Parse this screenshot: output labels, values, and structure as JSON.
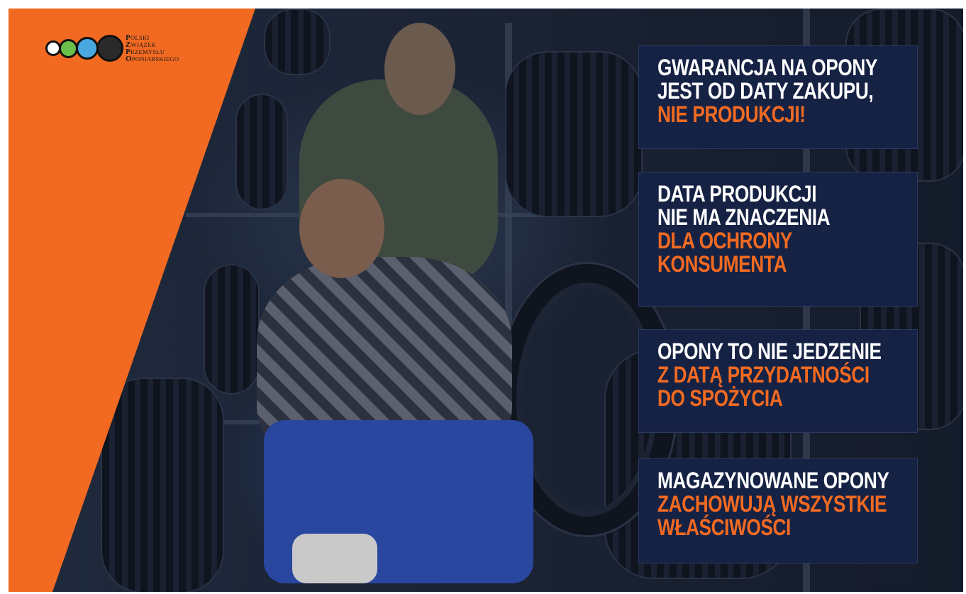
{
  "logo": {
    "lines": [
      {
        "cap": "P",
        "rest": "OLSKI"
      },
      {
        "cap": "Z",
        "rest": "WIĄZEK"
      },
      {
        "cap": "P",
        "rest": "RZEMYSŁU"
      },
      {
        "cap": "O",
        "rest": "PONIARSKIEGO"
      }
    ],
    "dot_colors": [
      "#ffffff",
      "#6ac04a",
      "#4aa8e0",
      "#2a2a2a"
    ]
  },
  "colors": {
    "accent": "#f26a21",
    "panel_bg": "#162244",
    "text": "#ffffff"
  },
  "panels": [
    {
      "white": [
        "GWARANCJA NA OPONY",
        "JEST OD DATY ZAKUPU,"
      ],
      "orange": [
        "NIE PRODUKCJI!"
      ]
    },
    {
      "white": [
        "DATA PRODUKCJI",
        "NIE MA ZNACZENIA"
      ],
      "orange": [
        "DLA OCHRONY",
        "KONSUMENTA"
      ]
    },
    {
      "white": [
        "OPONY TO NIE JEDZENIE"
      ],
      "orange": [
        "Z DATĄ PRZYDATNOŚCI",
        "DO SPOŻYCIA"
      ]
    },
    {
      "white": [
        "MAGAZYNOWANE OPONY"
      ],
      "orange": [
        "ZACHOWUJĄ WSZYSTKIE",
        "WŁAŚCIWOŚCI"
      ]
    }
  ]
}
